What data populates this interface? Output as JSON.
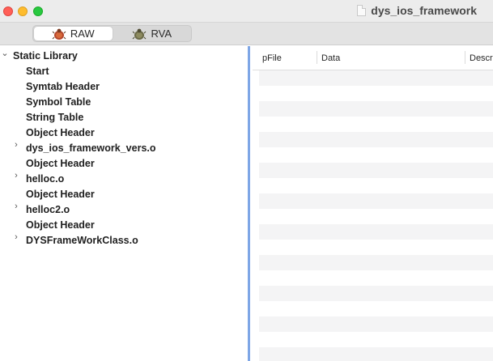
{
  "window": {
    "title": "dys_ios_framework"
  },
  "toolbar": {
    "modes": [
      {
        "label": "RAW",
        "icon": "bug-icon",
        "active": true
      },
      {
        "label": "RVA",
        "icon": "bug-icon",
        "active": false
      }
    ]
  },
  "tree": {
    "root": {
      "label": "Static Library",
      "expanded": true
    },
    "items": [
      {
        "label": "Start",
        "expandable": false
      },
      {
        "label": "Symtab Header",
        "expandable": false
      },
      {
        "label": "Symbol Table",
        "expandable": false
      },
      {
        "label": "String Table",
        "expandable": false
      },
      {
        "label": "Object Header",
        "expandable": false
      },
      {
        "label": "dys_ios_framework_vers.o",
        "expandable": true
      },
      {
        "label": "Object Header",
        "expandable": false
      },
      {
        "label": "helloc.o",
        "expandable": true
      },
      {
        "label": "Object Header",
        "expandable": false
      },
      {
        "label": "helloc2.o",
        "expandable": true
      },
      {
        "label": "Object Header",
        "expandable": false
      },
      {
        "label": "DYSFrameWorkClass.o",
        "expandable": true
      }
    ]
  },
  "table": {
    "columns": [
      "pFile",
      "Data",
      "Descr"
    ]
  },
  "colors": {
    "splitter": "#7ea6e6",
    "stripe": "#f4f4f5",
    "close": "#ff5f57",
    "minimize": "#febc2e",
    "maximize": "#28c840"
  }
}
